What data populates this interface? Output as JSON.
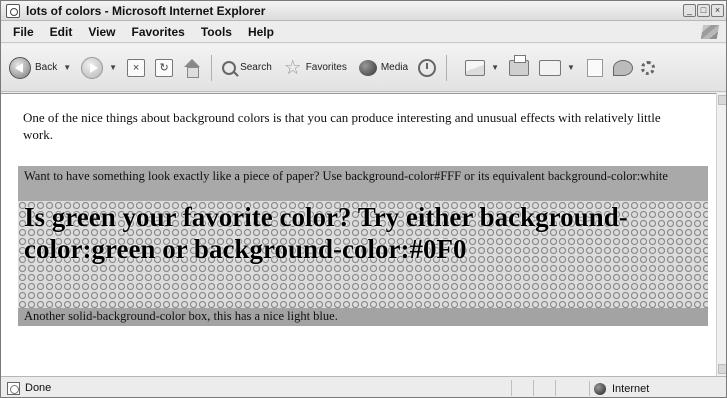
{
  "window": {
    "title": "lots of colors - Microsoft Internet Explorer"
  },
  "menu": [
    "File",
    "Edit",
    "View",
    "Favorites",
    "Tools",
    "Help"
  ],
  "toolbar": {
    "back_label": "Back",
    "search_label": "Search",
    "favorites_label": "Favorites",
    "media_label": "Media"
  },
  "page": {
    "intro": "One of the nice things about background colors is that you can produce interesting and unusual effects with relatively little work.",
    "gray_box": "Want to have something look exactly like a piece of paper? Use background-color#FFF or its equivalent background-color:white",
    "pattern_box": "Is green your favorite color? Try either background-color:green or background-color:#0F0",
    "blue_box": "Another solid-background-color box, this has a nice light blue."
  },
  "status": {
    "text": "Done",
    "zone": "Internet"
  }
}
